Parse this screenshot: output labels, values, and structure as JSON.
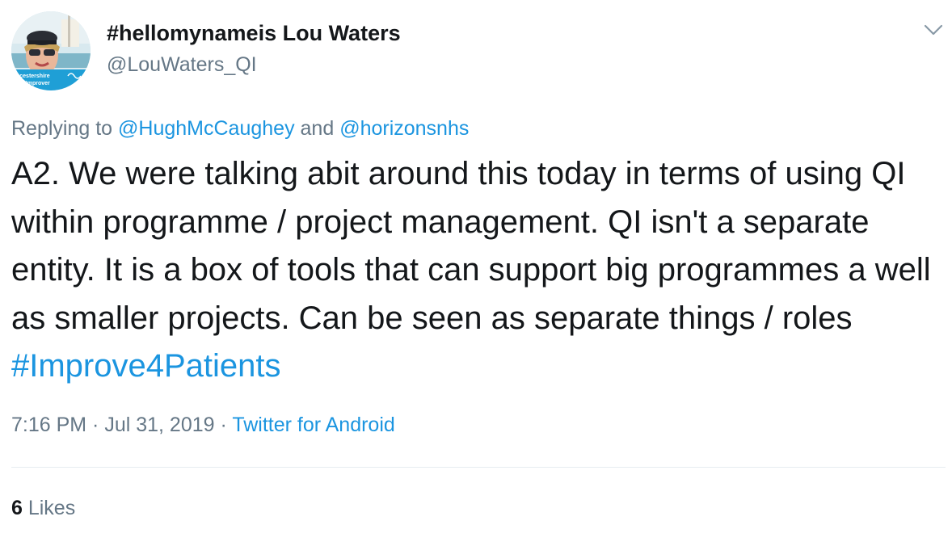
{
  "author": {
    "display_name": "#hellomynameis Lou Waters",
    "handle": "@LouWaters_QI",
    "avatar_text_line1": "ucestershire",
    "avatar_text_line2": "ls Improver"
  },
  "reply": {
    "prefix": "Replying to ",
    "mention1": "@HughMcCaughey",
    "conjunction": " and ",
    "mention2": "@horizonsnhs"
  },
  "tweet": {
    "text_before_hashtag": "A2. We were talking abit around this today in terms of using QI within programme / project management. QI isn't a separate entity. It is a box of tools that can support big programmes a well as smaller projects. Can be seen as separate things / roles ",
    "hashtag": "#Improve4Patients"
  },
  "meta": {
    "time": "7:16 PM",
    "separator1": " · ",
    "date": "Jul 31, 2019",
    "separator2": " · ",
    "source": "Twitter for Android"
  },
  "stats": {
    "likes_count": "6",
    "likes_label": " Likes"
  },
  "icons": {
    "menu": "chevron-down-icon"
  },
  "colors": {
    "link": "#1b95e0",
    "secondary_text": "#657786",
    "primary_text": "#14171a",
    "divider": "#e6ecf0"
  }
}
